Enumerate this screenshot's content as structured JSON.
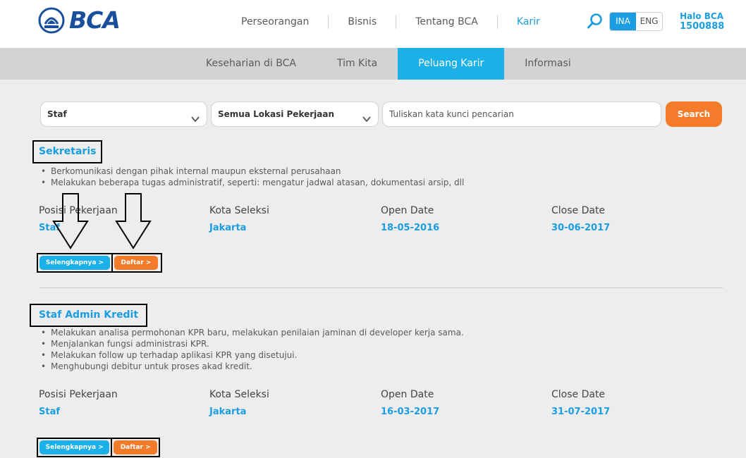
{
  "header": {
    "brand": "BCA",
    "nav": [
      "Perseorangan",
      "Bisnis",
      "Tentang BCA",
      "Karir"
    ],
    "lang": [
      "INA",
      "ENG"
    ],
    "halo_line1": "Halo BCA",
    "halo_line2": "1500888"
  },
  "subnav": [
    "Keseharian di BCA",
    "Tim Kita",
    "Peluang Karir",
    "Informasi"
  ],
  "filters": {
    "position": "Staf",
    "location": "Semua Lokasi Pekerjaan",
    "keyword_placeholder": "Tuliskan kata kunci pencarian",
    "search_label": "Search"
  },
  "labels": {
    "position": "Posisi Pekerjaan",
    "city": "Kota Seleksi",
    "open": "Open Date",
    "close": "Close Date",
    "detail_button": "Selengkapnya >",
    "apply_button": "Daftar >"
  },
  "jobs": [
    {
      "title": "Sekretaris",
      "duties": [
        "Berkomunikasi dengan pihak internal maupun eksternal perusahaan",
        "Melakukan beberapa tugas administratif, seperti: mengatur jadwal atasan, dokumentasi arsip, dll"
      ],
      "position": "Staf",
      "city": "Jakarta",
      "open": "18-05-2016",
      "close": "30-06-2017"
    },
    {
      "title": "Staf Admin Kredit",
      "duties": [
        "Melakukan analisa permohonan KPR baru, melakukan penilaian jaminan di developer kerja sama.",
        "Menjalankan fungsi administrasi KPR.",
        "Melakukan follow up terhadap aplikasi KPR yang disetujui.",
        "Menghubungi debitur untuk proses akad kredit."
      ],
      "position": "Staf",
      "city": "Jakarta",
      "open": "16-03-2017",
      "close": "31-07-2017"
    }
  ],
  "colors": {
    "accent_blue": "#1b9de2",
    "button_orange": "#f47b2a",
    "brand_navy": "#1a4f9c"
  }
}
